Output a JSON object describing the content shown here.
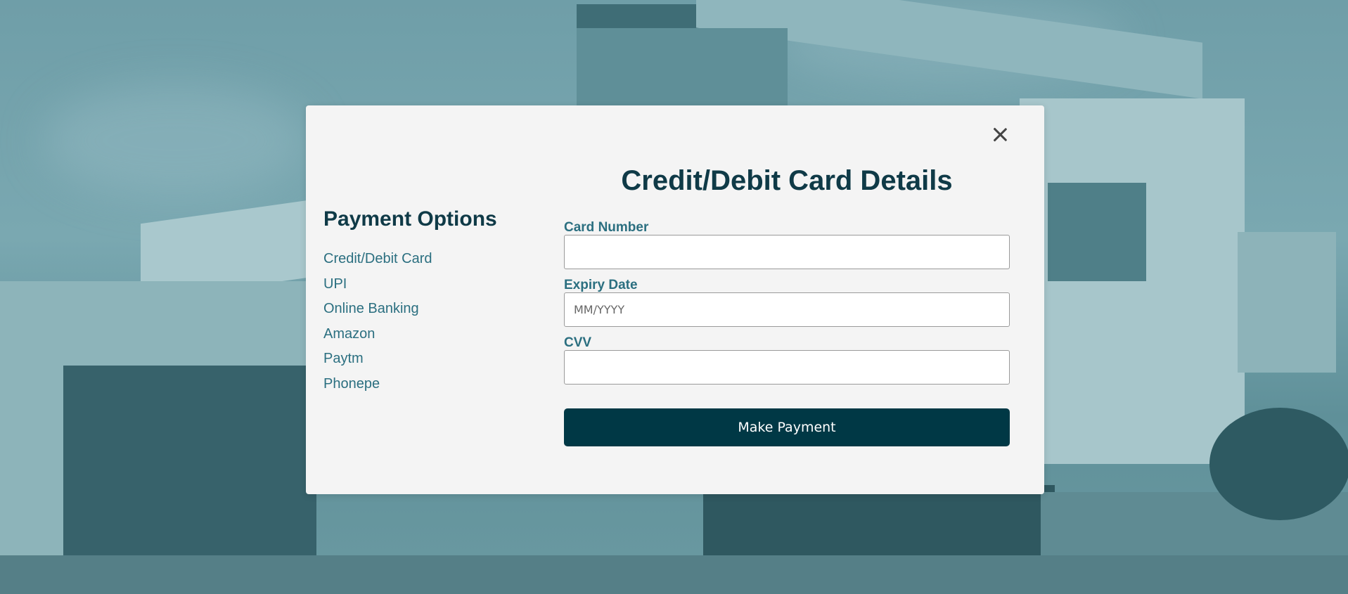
{
  "payment_options": {
    "title": "Payment Options",
    "items": [
      {
        "label": "Credit/Debit Card"
      },
      {
        "label": "UPI"
      },
      {
        "label": "Online Banking"
      },
      {
        "label": "Amazon"
      },
      {
        "label": "Paytm"
      },
      {
        "label": "Phonepe"
      }
    ]
  },
  "card_form": {
    "title": "Credit/Debit Card Details",
    "card_number": {
      "label": "Card Number",
      "value": "",
      "placeholder": ""
    },
    "expiry_date": {
      "label": "Expiry Date",
      "value": "",
      "placeholder": "MM/YYYY"
    },
    "cvv": {
      "label": "CVV",
      "value": "",
      "placeholder": ""
    },
    "submit_label": "Make Payment"
  },
  "icons": {
    "close": "close-icon"
  },
  "colors": {
    "heading": "#0f3a47",
    "link": "#2b6f80",
    "button_bg": "#003845",
    "modal_bg": "#f4f4f4",
    "overlay_tint": "#6a9ca6"
  }
}
